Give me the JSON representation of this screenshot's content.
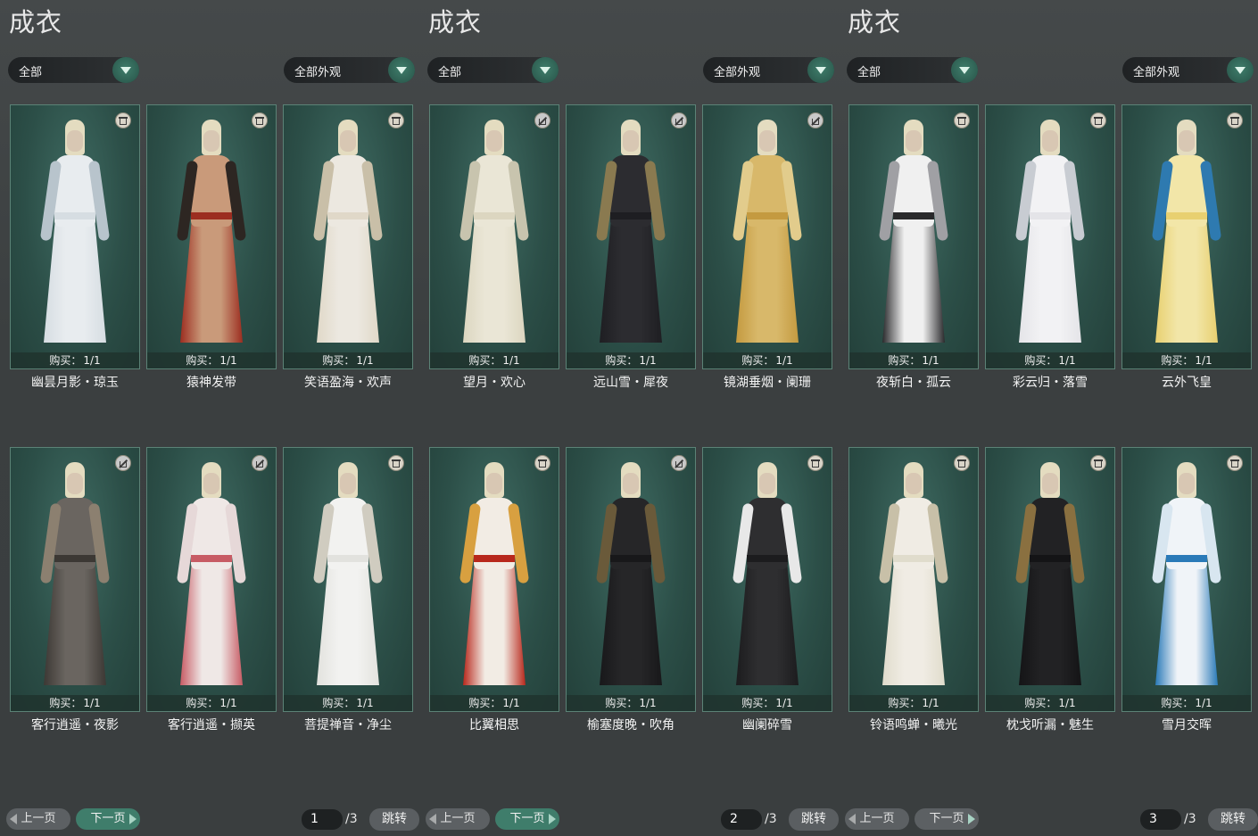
{
  "panels": [
    {
      "title": "成衣",
      "filter_left": "全部",
      "filter_right": "全部外观",
      "prev_label": "上一页",
      "next_label": "下一页",
      "page_current": "1",
      "page_total": "/3",
      "jump_label": "跳转",
      "cards": [
        {
          "name": "幽昙月影・琼玉",
          "buy_label": "购买：",
          "buy_count": "1/1",
          "icon": "trash-icon",
          "palette": [
            "#e8ecef",
            "#d6dde2",
            "#b8c4cc"
          ]
        },
        {
          "name": "猿神发带",
          "buy_label": "购买：",
          "buy_count": "1/1",
          "icon": "trash-icon",
          "palette": [
            "#c99a7a",
            "#9c2d20",
            "#2d2622"
          ]
        },
        {
          "name": "笑语盈海・欢声",
          "buy_label": "购买：",
          "buy_count": "1/1",
          "icon": "trash-icon",
          "palette": [
            "#ece8e0",
            "#e0d8c8",
            "#c9bfa8"
          ]
        },
        {
          "name": "客行逍遥・夜影",
          "buy_label": "购买：",
          "buy_count": "1/1",
          "icon": "disabled-trash-icon",
          "palette": [
            "#6a6560",
            "#3c3834",
            "#8c8070"
          ]
        },
        {
          "name": "客行逍遥・撷英",
          "buy_label": "购买：",
          "buy_count": "1/1",
          "icon": "disabled-trash-icon",
          "palette": [
            "#efe8e6",
            "#c75b64",
            "#e6d8d8"
          ]
        },
        {
          "name": "菩提禅音・净尘",
          "buy_label": "购买：",
          "buy_count": "1/1",
          "icon": "trash-icon",
          "palette": [
            "#f2f2f0",
            "#e2e2de",
            "#d0ccc0"
          ]
        }
      ]
    },
    {
      "title": "成衣",
      "filter_left": "全部",
      "filter_right": "全部外观",
      "prev_label": "上一页",
      "next_label": "下一页",
      "page_current": "2",
      "page_total": "/3",
      "jump_label": "跳转",
      "cards": [
        {
          "name": "望月・欢心",
          "buy_label": "购买：",
          "buy_count": "1/1",
          "icon": "disabled-trash-icon",
          "palette": [
            "#eae6d6",
            "#dcd6c0",
            "#c8c4ae"
          ]
        },
        {
          "name": "远山雪・犀夜",
          "buy_label": "购买：",
          "buy_count": "1/1",
          "icon": "disabled-trash-icon",
          "palette": [
            "#2c2c30",
            "#1e1e22",
            "#8a7a50"
          ]
        },
        {
          "name": "镜湖垂烟・阑珊",
          "buy_label": "购买：",
          "buy_count": "1/1",
          "icon": "disabled-trash-icon",
          "palette": [
            "#d8b86a",
            "#c49a40",
            "#e2cc8c"
          ]
        },
        {
          "name": "比翼相思",
          "buy_label": "购买：",
          "buy_count": "1/1",
          "icon": "trash-icon",
          "palette": [
            "#f2ece4",
            "#b8281c",
            "#d8a040"
          ]
        },
        {
          "name": "榆塞度晚・吹角",
          "buy_label": "购买：",
          "buy_count": "1/1",
          "icon": "disabled-trash-icon",
          "palette": [
            "#262628",
            "#18181a",
            "#6a5a3a"
          ]
        },
        {
          "name": "幽阑碎雪",
          "buy_label": "购买：",
          "buy_count": "1/1",
          "icon": "trash-icon",
          "palette": [
            "#2e2e30",
            "#1c1c1e",
            "#e8e8e8"
          ]
        }
      ]
    },
    {
      "title": "成衣",
      "filter_left": "全部",
      "filter_right": "全部外观",
      "prev_label": "上一页",
      "next_label": "下一页",
      "page_current": "3",
      "page_total": "/3",
      "jump_label": "跳转",
      "cards": [
        {
          "name": "夜斩白・孤云",
          "buy_label": "购买：",
          "buy_count": "1/1",
          "icon": "trash-icon",
          "palette": [
            "#f0f0f0",
            "#2a2a2c",
            "#a0a0a4"
          ]
        },
        {
          "name": "彩云归・落雪",
          "buy_label": "购买：",
          "buy_count": "1/1",
          "icon": "trash-icon",
          "palette": [
            "#f2f2f4",
            "#e4e4e8",
            "#c8ccd2"
          ]
        },
        {
          "name": "云外飞皇",
          "buy_label": "购买：",
          "buy_count": "1/1",
          "icon": "trash-icon",
          "palette": [
            "#f2e6a8",
            "#e8d070",
            "#2e7ab0"
          ]
        },
        {
          "name": "铃语鸣蝉・曦光",
          "buy_label": "购买：",
          "buy_count": "1/1",
          "icon": "trash-icon",
          "palette": [
            "#f0ece4",
            "#e0dccc",
            "#c8c0a8"
          ]
        },
        {
          "name": "枕戈听漏・魅生",
          "buy_label": "购买：",
          "buy_count": "1/1",
          "icon": "trash-icon",
          "palette": [
            "#222224",
            "#141416",
            "#8a7040"
          ]
        },
        {
          "name": "雪月交晖",
          "buy_label": "购买：",
          "buy_count": "1/1",
          "icon": "trash-icon",
          "palette": [
            "#f0f4f8",
            "#2a7ab8",
            "#d8e6f0"
          ]
        }
      ]
    }
  ]
}
